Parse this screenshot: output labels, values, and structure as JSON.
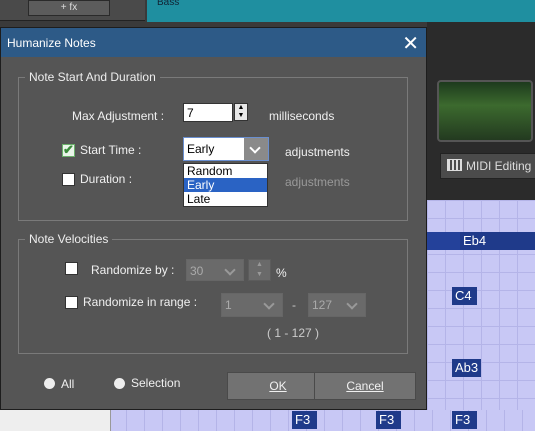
{
  "background": {
    "fx_label": "+ fx",
    "track_label": "Bass",
    "midi_tab_label": "MIDI Editing",
    "notes": [
      "Eb4",
      "C4",
      "Ab3",
      "F3",
      "F3",
      "F3"
    ]
  },
  "dialog": {
    "title": "Humanize Notes",
    "close_icon": "close-icon",
    "start_group": {
      "legend": "Note Start And Duration",
      "max_adjustment_label": "Max Adjustment :",
      "max_adjustment_value": "7",
      "max_adjustment_unit": "milliseconds",
      "start_time": {
        "label": "Start Time :",
        "checked": true,
        "selected": "Early",
        "options": [
          "Random",
          "Early",
          "Late"
        ],
        "suffix": "adjustments"
      },
      "duration": {
        "label": "Duration :",
        "checked": false,
        "suffix": "adjustments"
      }
    },
    "velocity_group": {
      "legend": "Note Velocities",
      "randomize_by": {
        "label": "Randomize by :",
        "value": "30",
        "unit": "%",
        "checked": false
      },
      "randomize_range": {
        "label": "Randomize in range :",
        "min": "1",
        "separator": "-",
        "max": "127",
        "hint": "( 1 - 127 )",
        "checked": false
      }
    },
    "scope": {
      "all_label": "All",
      "selection_label": "Selection"
    },
    "ok_label": "OK",
    "cancel_label": "Cancel"
  }
}
